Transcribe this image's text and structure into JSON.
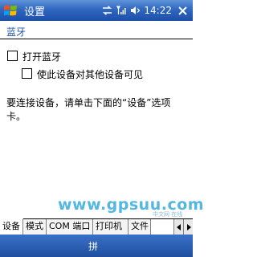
{
  "titlebar": {
    "title": "设置",
    "time": "14:22"
  },
  "section": {
    "label": "蓝牙"
  },
  "options": {
    "enable_label": "打开蓝牙",
    "visible_label": "使此设备对其他设备可见"
  },
  "description": "要连接设备，请单击下面的“设备”选项卡。",
  "watermark": {
    "text": "www.gpsuu.com",
    "sub": "中文网 在线"
  },
  "tabs": [
    "设备",
    "模式",
    "COM 端口",
    "打印机",
    "文件"
  ],
  "bottombar": {
    "ime": "拼"
  },
  "colors": {
    "titlebar": "#2f67c1",
    "section_label": "#1f52a8",
    "watermark": "#1aa0d8"
  }
}
